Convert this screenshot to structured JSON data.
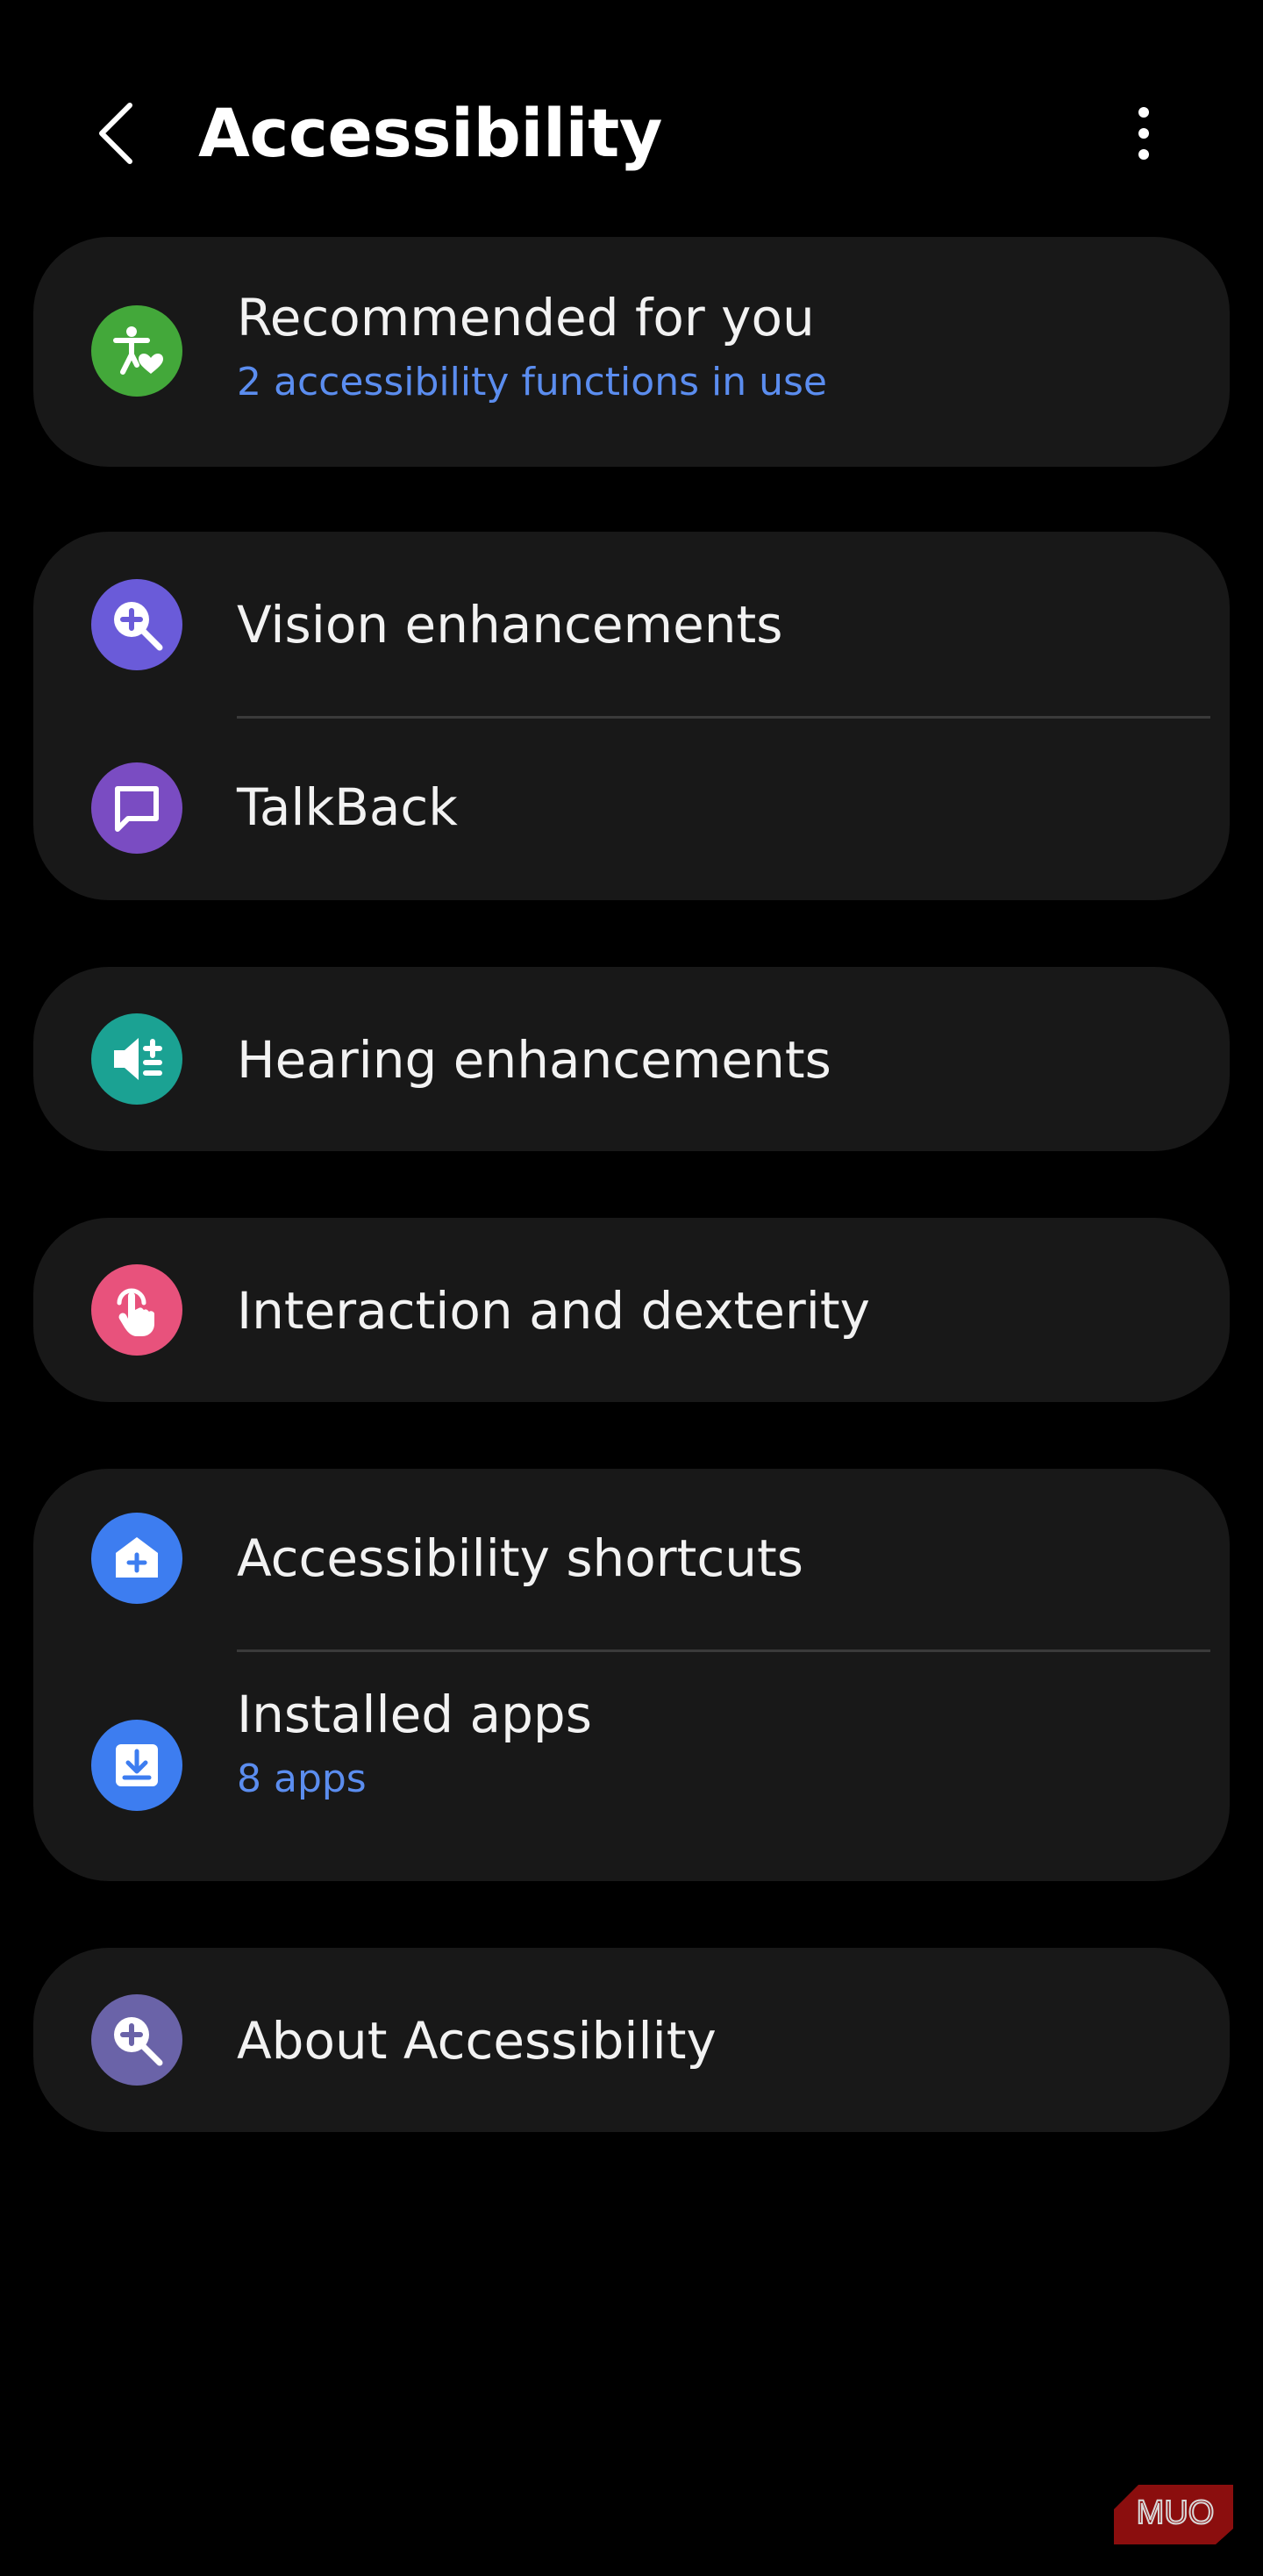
{
  "header": {
    "title": "Accessibility",
    "back_icon": "chevron-left-icon",
    "more_icon": "more-vertical-icon"
  },
  "colors": {
    "background": "#000000",
    "card": "#181818",
    "accent_text": "#5B8DEF",
    "divider": "#3A3A3A"
  },
  "items": {
    "recommended": {
      "label": "Recommended for you",
      "subtitle": "2 accessibility functions in use",
      "icon": "accessibility-heart-icon",
      "color": "#43A83A"
    },
    "vision": {
      "label": "Vision enhancements",
      "icon": "zoom-in-icon",
      "color": "#6A5BD9"
    },
    "talkback": {
      "label": "TalkBack",
      "icon": "chat-bubble-icon",
      "color": "#7A4CC2"
    },
    "hearing": {
      "label": "Hearing enhancements",
      "icon": "speaker-plus-icon",
      "color": "#1BA293"
    },
    "interaction": {
      "label": "Interaction and dexterity",
      "icon": "touch-hand-icon",
      "color": "#E8527C"
    },
    "shortcuts": {
      "label": "Accessibility shortcuts",
      "icon": "shortcut-plus-icon",
      "color": "#3D7DF0"
    },
    "installed": {
      "label": "Installed apps",
      "subtitle": "8 apps",
      "icon": "download-icon",
      "color": "#3D7DF0"
    },
    "about": {
      "label": "About Accessibility",
      "icon": "zoom-info-icon",
      "color": "#6A63A8"
    }
  },
  "watermark": {
    "text": "MUO",
    "color": "#8B0E0E"
  }
}
